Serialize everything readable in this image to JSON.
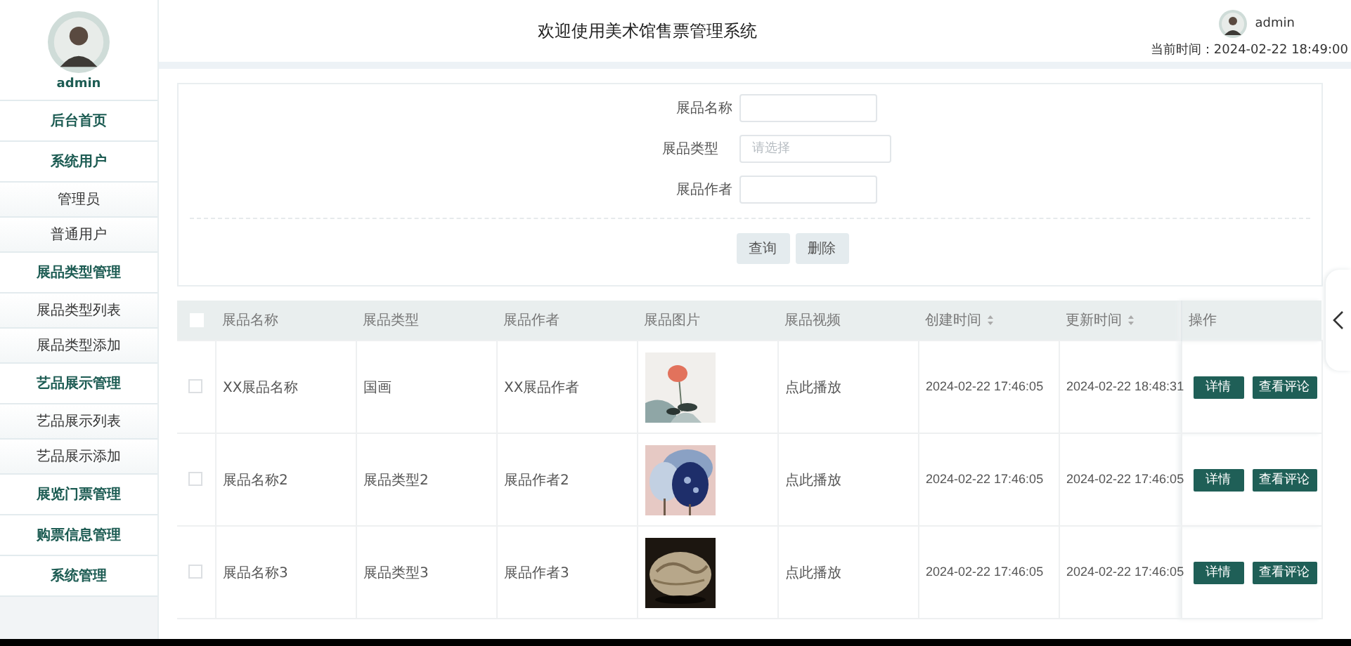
{
  "sidebar": {
    "user": "admin",
    "menu": [
      {
        "label": "后台首页"
      },
      {
        "label": "系统用户",
        "children": [
          {
            "label": "管理员"
          },
          {
            "label": "普通用户"
          }
        ]
      },
      {
        "label": "展品类型管理",
        "children": [
          {
            "label": "展品类型列表"
          },
          {
            "label": "展品类型添加"
          }
        ]
      },
      {
        "label": "艺品展示管理",
        "children": [
          {
            "label": "艺品展示列表"
          },
          {
            "label": "艺品展示添加"
          }
        ]
      },
      {
        "label": "展览门票管理"
      },
      {
        "label": "购票信息管理"
      },
      {
        "label": "系统管理"
      }
    ]
  },
  "header": {
    "title": "欢迎使用美术馆售票管理系统",
    "user": "admin",
    "time": "当前时间：2024-02-22 18:49:00"
  },
  "search": {
    "fields": [
      {
        "kind": "text",
        "label": "展品名称"
      },
      {
        "kind": "select",
        "label": "展品类型",
        "placeholder": "请选择"
      },
      {
        "kind": "text",
        "label": "展品作者"
      }
    ],
    "buttons": [
      "查询",
      "删除"
    ]
  },
  "table": {
    "select_all": {
      "checked": false
    },
    "columns": [
      {
        "label": "展品名称",
        "sortable": false
      },
      {
        "label": "展品类型",
        "sortable": false
      },
      {
        "label": "展品作者",
        "sortable": false
      },
      {
        "label": "展品图片",
        "sortable": false
      },
      {
        "label": "展品视频",
        "sortable": false
      },
      {
        "label": "创建时间",
        "sortable": true
      },
      {
        "label": "更新时间",
        "sortable": true
      },
      {
        "label": "操作",
        "sortable": false
      }
    ],
    "rows": [
      {
        "checked": false,
        "name": "XX展品名称",
        "type": "国画",
        "author": "XX展品作者",
        "picture": {
          "kind": "picture"
        },
        "video": "点此播放",
        "created": "2024-02-22 17:46:05",
        "updated": "2024-02-22 18:48:31",
        "actions": [
          "详情",
          "查看评论"
        ]
      },
      {
        "checked": false,
        "name": "展品名称2",
        "type": "展品类型2",
        "author": "展品作者2",
        "picture": {
          "kind": "picture"
        },
        "video": "点此播放",
        "created": "2024-02-22 17:46:05",
        "updated": "2024-02-22 17:46:05",
        "actions": [
          "详情",
          "查看评论"
        ]
      },
      {
        "checked": false,
        "name": "展品名称3",
        "type": "展品类型3",
        "author": "展品作者3",
        "picture": {
          "kind": "picture"
        },
        "video": "点此播放",
        "created": "2024-02-22 17:46:05",
        "updated": "2024-02-22 17:46:05",
        "actions": [
          "详情",
          "查看评论"
        ]
      }
    ]
  }
}
